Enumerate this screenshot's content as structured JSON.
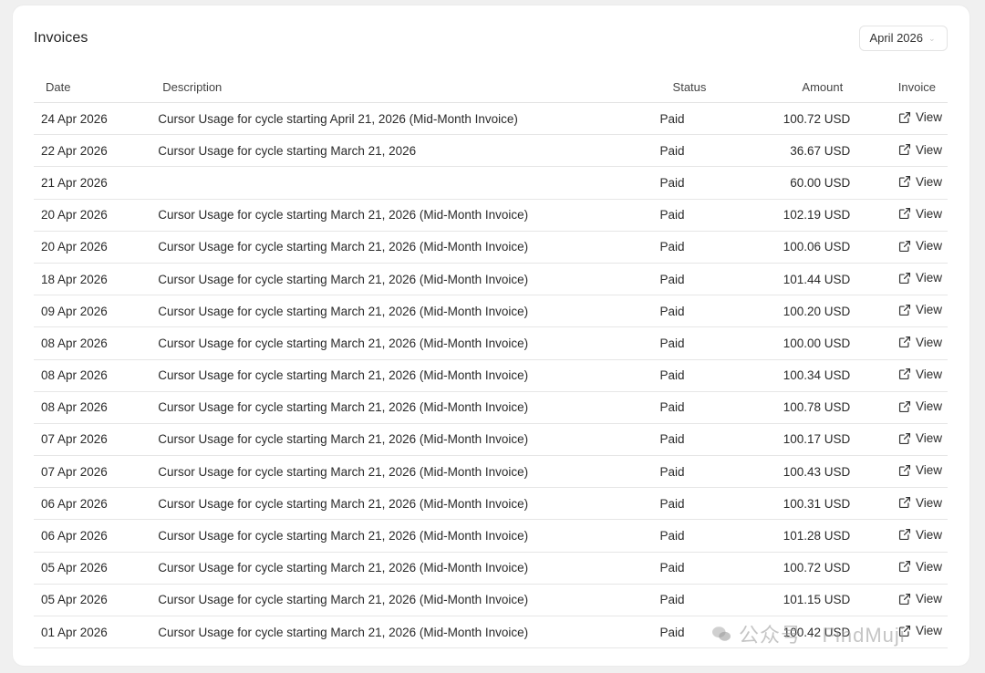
{
  "header": {
    "title": "Invoices",
    "month_select": "April 2026"
  },
  "table": {
    "columns": {
      "date": "Date",
      "description": "Description",
      "status": "Status",
      "amount": "Amount",
      "invoice": "Invoice"
    },
    "view_label": "View",
    "rows": [
      {
        "date": "24 Apr 2026",
        "description": "Cursor Usage for cycle starting April 21, 2026 (Mid-Month Invoice)",
        "status": "Paid",
        "amount": "100.72 USD"
      },
      {
        "date": "22 Apr 2026",
        "description": "Cursor Usage for cycle starting March 21, 2026",
        "status": "Paid",
        "amount": "36.67 USD"
      },
      {
        "date": "21 Apr 2026",
        "description": "",
        "status": "Paid",
        "amount": "60.00 USD"
      },
      {
        "date": "20 Apr 2026",
        "description": "Cursor Usage for cycle starting March 21, 2026 (Mid-Month Invoice)",
        "status": "Paid",
        "amount": "102.19 USD"
      },
      {
        "date": "20 Apr 2026",
        "description": "Cursor Usage for cycle starting March 21, 2026 (Mid-Month Invoice)",
        "status": "Paid",
        "amount": "100.06 USD"
      },
      {
        "date": "18 Apr 2026",
        "description": "Cursor Usage for cycle starting March 21, 2026 (Mid-Month Invoice)",
        "status": "Paid",
        "amount": "101.44 USD"
      },
      {
        "date": "09 Apr 2026",
        "description": "Cursor Usage for cycle starting March 21, 2026 (Mid-Month Invoice)",
        "status": "Paid",
        "amount": "100.20 USD"
      },
      {
        "date": "08 Apr 2026",
        "description": "Cursor Usage for cycle starting March 21, 2026 (Mid-Month Invoice)",
        "status": "Paid",
        "amount": "100.00 USD"
      },
      {
        "date": "08 Apr 2026",
        "description": "Cursor Usage for cycle starting March 21, 2026 (Mid-Month Invoice)",
        "status": "Paid",
        "amount": "100.34 USD"
      },
      {
        "date": "08 Apr 2026",
        "description": "Cursor Usage for cycle starting March 21, 2026 (Mid-Month Invoice)",
        "status": "Paid",
        "amount": "100.78 USD"
      },
      {
        "date": "07 Apr 2026",
        "description": "Cursor Usage for cycle starting March 21, 2026 (Mid-Month Invoice)",
        "status": "Paid",
        "amount": "100.17 USD"
      },
      {
        "date": "07 Apr 2026",
        "description": "Cursor Usage for cycle starting March 21, 2026 (Mid-Month Invoice)",
        "status": "Paid",
        "amount": "100.43 USD"
      },
      {
        "date": "06 Apr 2026",
        "description": "Cursor Usage for cycle starting March 21, 2026 (Mid-Month Invoice)",
        "status": "Paid",
        "amount": "100.31 USD"
      },
      {
        "date": "06 Apr 2026",
        "description": "Cursor Usage for cycle starting March 21, 2026 (Mid-Month Invoice)",
        "status": "Paid",
        "amount": "101.28 USD"
      },
      {
        "date": "05 Apr 2026",
        "description": "Cursor Usage for cycle starting March 21, 2026 (Mid-Month Invoice)",
        "status": "Paid",
        "amount": "100.72 USD"
      },
      {
        "date": "05 Apr 2026",
        "description": "Cursor Usage for cycle starting March 21, 2026 (Mid-Month Invoice)",
        "status": "Paid",
        "amount": "101.15 USD"
      },
      {
        "date": "01 Apr 2026",
        "description": "Cursor Usage for cycle starting March 21, 2026 (Mid-Month Invoice)",
        "status": "Paid",
        "amount": "100.42 USD"
      }
    ]
  },
  "watermark": {
    "text": "公众号 · FindMuji"
  },
  "icons": {
    "view": "external-link-icon",
    "select": "chevron-down-icon",
    "watermark_logo": "wechat-icon"
  }
}
